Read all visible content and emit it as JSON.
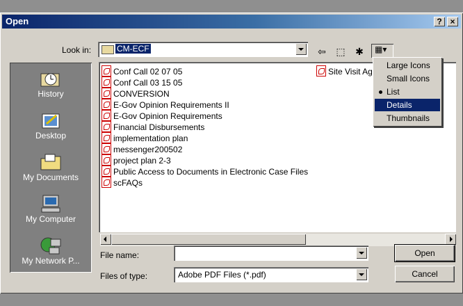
{
  "window": {
    "title": "Open",
    "help_button": "?",
    "close_button": "×"
  },
  "look_in": {
    "label": "Look in:",
    "value": "CM-ECF",
    "icon": "folder-icon"
  },
  "toolbar": {
    "back_icon": "⇦",
    "up_icon": "⬚",
    "new_folder_icon": "✱",
    "view_icon": "▦▾"
  },
  "view_menu": {
    "items": [
      {
        "label": "Large Icons",
        "selected": false,
        "highlighted": false
      },
      {
        "label": "Small Icons",
        "selected": false,
        "highlighted": false
      },
      {
        "label": "List",
        "selected": true,
        "highlighted": false
      },
      {
        "label": "Details",
        "selected": false,
        "highlighted": true
      },
      {
        "label": "Thumbnails",
        "selected": false,
        "highlighted": false
      }
    ]
  },
  "places": [
    {
      "label": "History"
    },
    {
      "label": "Desktop"
    },
    {
      "label": "My Documents"
    },
    {
      "label": "My Computer"
    },
    {
      "label": "My Network P..."
    }
  ],
  "files": [
    "Conf Call 02 07 05",
    "Conf Call 03 15 05",
    "CONVERSION",
    "E-Gov Opinion Requirements II",
    "E-Gov Opinion Requirements",
    "Financial Disbursements",
    "implementation plan",
    "messenger200502",
    "project plan 2-3",
    "Public Access to Documents in Electronic Case Files",
    "scFAQs",
    "Site Visit Ag"
  ],
  "file_name": {
    "label": "File name:",
    "value": ""
  },
  "file_type": {
    "label": "Files of type:",
    "value": "Adobe PDF Files (*.pdf)"
  },
  "buttons": {
    "open": "Open",
    "cancel": "Cancel"
  }
}
